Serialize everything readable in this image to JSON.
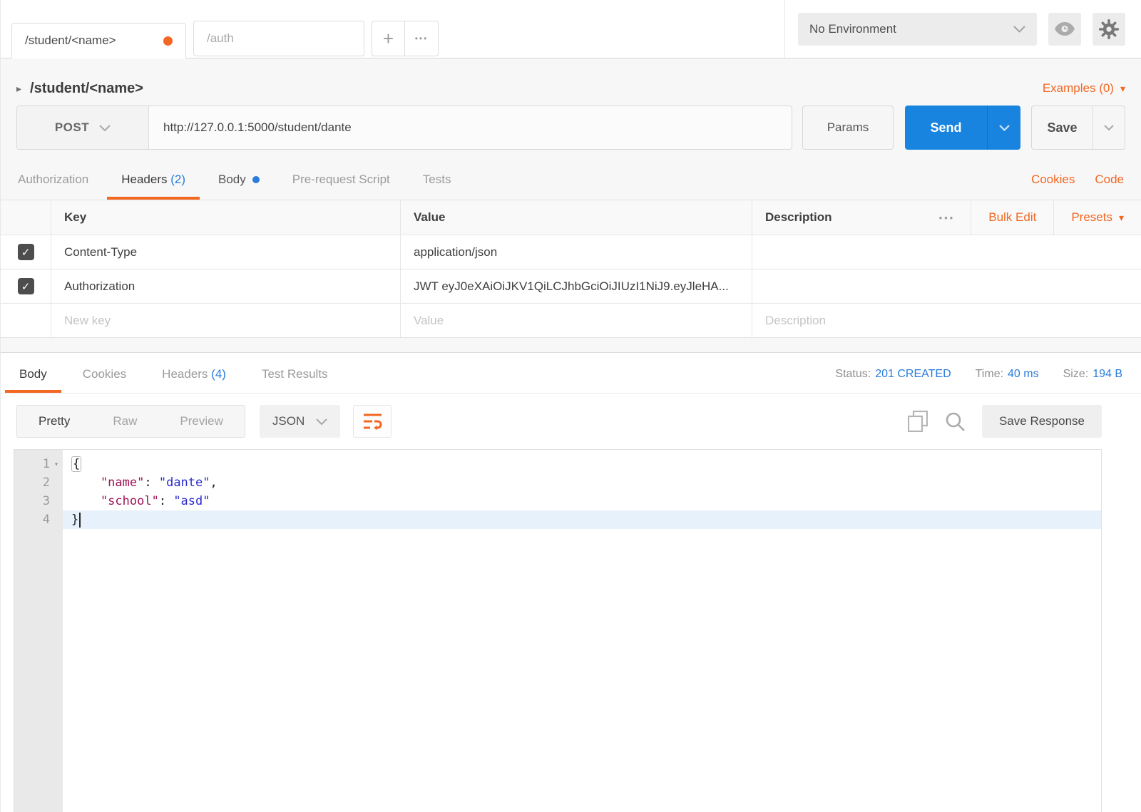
{
  "colors": {
    "accent_orange": "#f26722",
    "link_blue": "#2a7cdc",
    "send_blue": "#1884e0",
    "json_key": "#9d1457",
    "json_string": "#2b2bcd"
  },
  "icons": {
    "plus": "+",
    "more": "•••",
    "check": "✓",
    "caret_right": "▸",
    "caret_down": "▾",
    "fold_caret": "▾"
  },
  "topbar": {
    "request_tab": "/student/<name>",
    "auth_tab": "/auth",
    "environment": "No Environment"
  },
  "request": {
    "title": "/student/<name>",
    "examples": "Examples (0)",
    "method": "POST",
    "url": "http://127.0.0.1:5000/student/dante",
    "params": "Params",
    "send": "Send",
    "save": "Save",
    "tab_authorization": "Authorization",
    "tab_headers": "Headers",
    "headers_count": "(2)",
    "tab_body": "Body",
    "tab_prerequest": "Pre-request Script",
    "tab_tests": "Tests",
    "cookies": "Cookies",
    "code": "Code"
  },
  "headers_table": {
    "col_key": "Key",
    "col_value": "Value",
    "col_description": "Description",
    "bulk_edit": "Bulk Edit",
    "presets": "Presets",
    "rows": [
      {
        "key": "Content-Type",
        "value": "application/json"
      },
      {
        "key": "Authorization",
        "value": "JWT eyJ0eXAiOiJKV1QiLCJhbGciOiJIUzI1NiJ9.eyJleHA..."
      }
    ],
    "new_key_placeholder": "New key",
    "value_placeholder": "Value",
    "description_placeholder": "Description"
  },
  "response": {
    "tab_body": "Body",
    "tab_cookies": "Cookies",
    "tab_headers": "Headers",
    "headers_count": "(4)",
    "tab_tests": "Test Results",
    "status_label": "Status:",
    "status_value": "201 CREATED",
    "time_label": "Time:",
    "time_value": "40 ms",
    "size_label": "Size:",
    "size_value": "194 B",
    "view_pretty": "Pretty",
    "view_raw": "Raw",
    "view_preview": "Preview",
    "format": "JSON",
    "save_response": "Save Response"
  },
  "editor": {
    "line1": {
      "num": "1",
      "open_brace": "{"
    },
    "line2": {
      "num": "2",
      "key": "\"name\"",
      "sep": ": ",
      "value": "\"dante\"",
      "comma": ","
    },
    "line3": {
      "num": "3",
      "key": "\"school\"",
      "sep": ": ",
      "value": "\"asd\""
    },
    "line4": {
      "num": "4",
      "close_brace": "}"
    }
  }
}
